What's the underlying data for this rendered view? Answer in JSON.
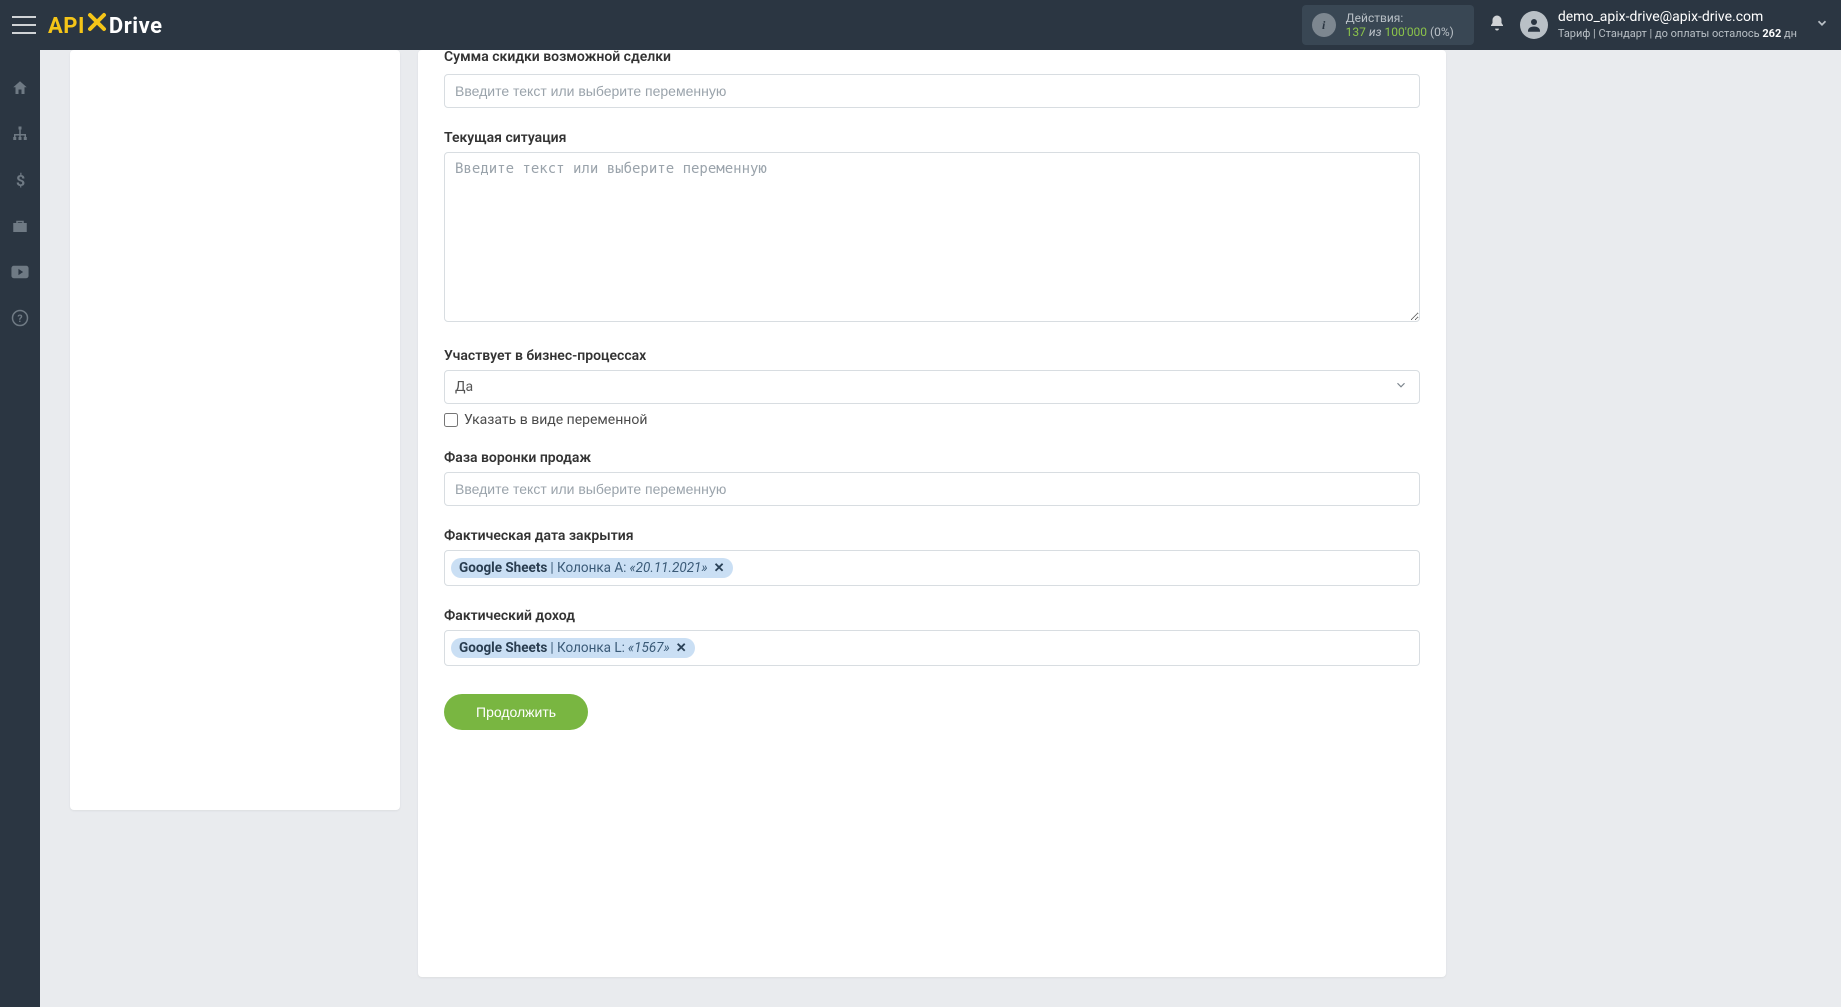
{
  "header": {
    "logo_api": "API",
    "logo_drive": "Drive",
    "actions": {
      "label": "Действия:",
      "current": "137",
      "of_word": "из",
      "total": "100'000",
      "pct": "(0%)"
    },
    "user": {
      "email": "demo_apix-drive@apix-drive.com",
      "plan_prefix": "Тариф | Стандарт | до оплаты осталось ",
      "days_left": "262",
      "plan_suffix": " дн"
    }
  },
  "fields": {
    "discount_sum": {
      "label": "Сумма скидки возможной сделки",
      "placeholder": "Введите текст или выберите переменную"
    },
    "current_situation": {
      "label": "Текущая ситуация",
      "placeholder": "Введите текст или выберите переменную"
    },
    "participates": {
      "label": "Участвует в бизнес-процессах",
      "selected": "Да",
      "checkbox_label": "Указать в виде переменной"
    },
    "funnel_phase": {
      "label": "Фаза воронки продаж",
      "placeholder": "Введите текст или выберите переменную"
    },
    "actual_close_date": {
      "label": "Фактическая дата закрытия",
      "chip": {
        "source": "Google Sheets",
        "column": " | Колонка A: ",
        "value": "«20.11.2021»"
      }
    },
    "actual_income": {
      "label": "Фактический доход",
      "chip": {
        "source": "Google Sheets",
        "column": " | Колонка L: ",
        "value": "«1567»"
      }
    }
  },
  "button": {
    "continue": "Продолжить"
  }
}
